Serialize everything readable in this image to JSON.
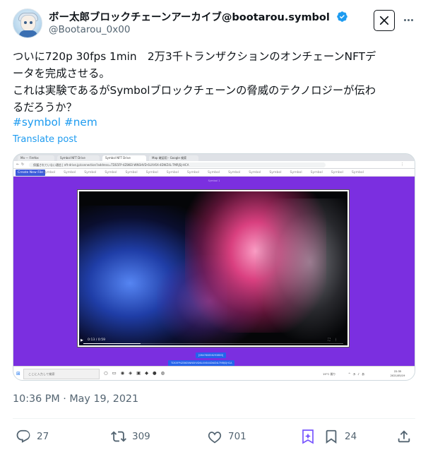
{
  "author": {
    "display_name": "ボー太郎ブロックチェーンアーカイブ@bootarou.symbol",
    "handle": "@Bootarou_0x00",
    "verified": true
  },
  "tweet": {
    "lines": [
      "ついに720p 30fps 1min　2万3千トランザクションのオンチェーンNFTデ",
      "ータを完成させる。",
      "これは実験であるがSymbolブロックチェーンの脅威のテクノロジーが伝わ",
      "るだろうか？"
    ],
    "hashtags": "#symbol #nem",
    "translate_label": "Translate post",
    "timestamp": "10:36 PM · May 19, 2021"
  },
  "media": {
    "browser_tabs": [
      "Ma — Firefox",
      "Symbol NFT Drive",
      "Symbol NFT Drive",
      "Map 確認用 - Google 検索"
    ],
    "url": "保護されていない通信 | nft-drive.jp/connection?address=TDS5FP-4Z8KEI-WNSHVD-6LXV6X-4DWZ4L-TMRJSJ-HCA",
    "create_button": "Create New File",
    "symbol_tabs": [
      "Symbol",
      "Symbol",
      "Symbol",
      "Symbol",
      "Symbol",
      "Symbol",
      "Symbol",
      "Symbol",
      "Symbol",
      "Symbol",
      "Symbol",
      "Symbol",
      "Symbol",
      "Symbol",
      "Symbol",
      "Symbol"
    ],
    "mini_label": "Symbol 1",
    "video_time": "0:13 / 0:59",
    "video_progress": 0.22,
    "hash_line_1": "[0847808582938B3]",
    "hash_line_2": "TDS5FP4Z8KEIWNSHVD6LXV6X4DWZ4LTMRJSJHCA",
    "taskbar_search": "ここに入力して検索",
    "weather": "19°C 曇り",
    "clock_time": "22:35",
    "clock_date": "2021/05/19"
  },
  "actions": {
    "replies": "27",
    "reposts": "309",
    "likes": "701",
    "bookmarks": "24"
  },
  "colors": {
    "link": "#1d9bf0",
    "muted": "#536471",
    "verified": "#1d9bf0",
    "video_bg_purple": "#7b2fe0"
  }
}
